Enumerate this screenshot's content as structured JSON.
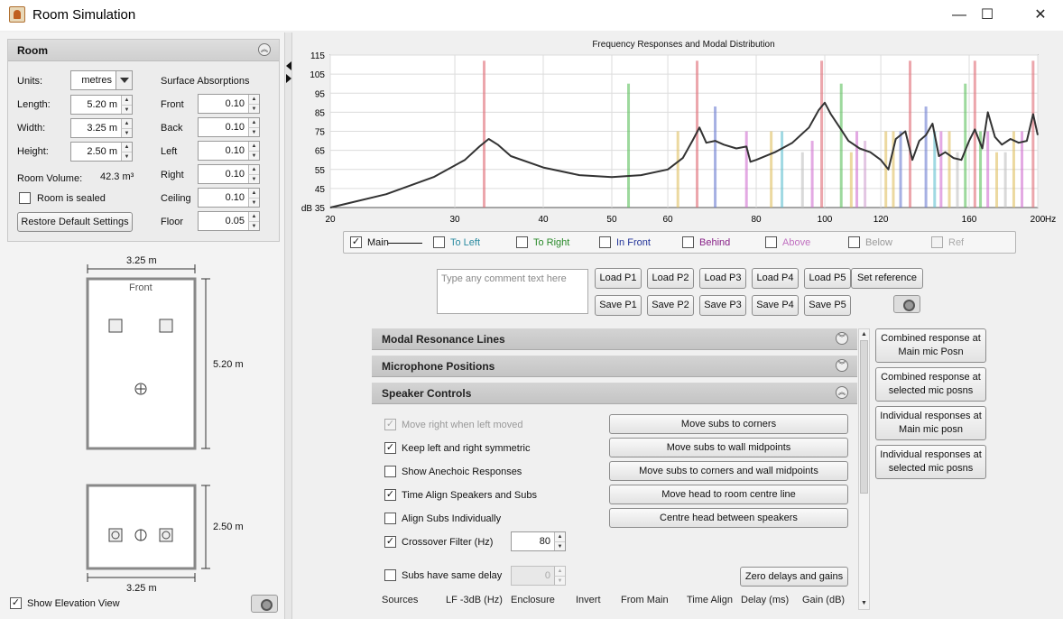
{
  "window": {
    "title": "Room Simulation",
    "minimize": "—",
    "maximize": "☐",
    "close": "✕"
  },
  "room": {
    "header": "Room",
    "units_label": "Units:",
    "units_value": "metres",
    "length_label": "Length:",
    "length_value": "5.20 m",
    "width_label": "Width:",
    "width_value": "3.25 m",
    "height_label": "Height:",
    "height_value": "2.50 m",
    "volume_label": "Room Volume:",
    "volume_value": "42.3 m³",
    "sealed_label": "Room is sealed",
    "restore_label": "Restore Default Settings",
    "absorption_title": "Surface Absorptions",
    "absorptions": [
      {
        "label": "Front",
        "value": "0.10"
      },
      {
        "label": "Back",
        "value": "0.10"
      },
      {
        "label": "Left",
        "value": "0.10"
      },
      {
        "label": "Right",
        "value": "0.10"
      },
      {
        "label": "Ceiling",
        "value": "0.10"
      },
      {
        "label": "Floor",
        "value": "0.05"
      }
    ]
  },
  "plan": {
    "width_label": "3.25 m",
    "length_label": "5.20 m",
    "front_label": "Front",
    "elev_width_label": "3.25 m",
    "elev_height_label": "2.50 m"
  },
  "elevation": {
    "show_label": "Show Elevation View"
  },
  "chart_data": {
    "type": "line",
    "title": "Frequency Responses and Modal Distribution",
    "x_scale": "log",
    "xlim": [
      20,
      200
    ],
    "ylim": [
      35,
      115
    ],
    "x_ticks": [
      20,
      30,
      40,
      50,
      60,
      80,
      100,
      120,
      160,
      200
    ],
    "x_tick_labels": [
      "20",
      "30",
      "40",
      "50",
      "60",
      "80",
      "100",
      "120",
      "160",
      "200"
    ],
    "x_unit": "Hz",
    "y_ticks": [
      115,
      105,
      95,
      85,
      75,
      65,
      55,
      45
    ],
    "y_bottom_label": "dB 35",
    "grid": true,
    "series": [
      {
        "x": [
          20,
          24,
          28,
          31,
          32.5,
          33.5,
          34.5,
          36,
          40,
          45,
          50,
          55,
          60,
          63,
          65,
          66.5,
          68,
          70,
          72,
          75,
          77.5,
          78.5,
          80,
          85,
          90,
          95,
          98,
          100,
          102,
          105,
          108,
          112,
          116,
          120,
          123,
          126,
          130,
          133,
          136,
          139,
          142,
          145,
          148,
          152,
          156,
          160,
          163,
          167,
          170,
          174,
          178,
          183,
          188,
          193,
          197,
          200
        ],
        "y": [
          35,
          42,
          51,
          60,
          67,
          71,
          68,
          62,
          56,
          52,
          51,
          52,
          55,
          61,
          70,
          77,
          69,
          70,
          68,
          66,
          67,
          59,
          60,
          64,
          69,
          77,
          86,
          90,
          84,
          77,
          70,
          66,
          64,
          60,
          55,
          71,
          75,
          60,
          70,
          73,
          79,
          62,
          64,
          61,
          60,
          70,
          76,
          66,
          85,
          72,
          68,
          71,
          69,
          70,
          84,
          73
        ]
      }
    ],
    "modal_lines": [
      {
        "x": 33.0,
        "y": 112,
        "color": "#e06a74"
      },
      {
        "x": 52.8,
        "y": 100,
        "color": "#5bbf5b"
      },
      {
        "x": 62.0,
        "y": 75,
        "color": "#e0c060"
      },
      {
        "x": 66.0,
        "y": 112,
        "color": "#e06a74"
      },
      {
        "x": 70.0,
        "y": 88,
        "color": "#6a7bd0"
      },
      {
        "x": 77.5,
        "y": 75,
        "color": "#d070d0"
      },
      {
        "x": 84.0,
        "y": 75,
        "color": "#e0c060"
      },
      {
        "x": 87.0,
        "y": 75,
        "color": "#60c0d0"
      },
      {
        "x": 93.0,
        "y": 64,
        "color": "#c0c0c0"
      },
      {
        "x": 96.0,
        "y": 70,
        "color": "#d070d0"
      },
      {
        "x": 99.0,
        "y": 112,
        "color": "#e06a74"
      },
      {
        "x": 105.5,
        "y": 100,
        "color": "#5bbf5b"
      },
      {
        "x": 109.0,
        "y": 64,
        "color": "#e0c060"
      },
      {
        "x": 111.0,
        "y": 75,
        "color": "#d070d0"
      },
      {
        "x": 114.0,
        "y": 70,
        "color": "#d0a0d0"
      },
      {
        "x": 122.0,
        "y": 75,
        "color": "#e0c060"
      },
      {
        "x": 125.0,
        "y": 75,
        "color": "#e0c060"
      },
      {
        "x": 128.0,
        "y": 75,
        "color": "#6a7bd0"
      },
      {
        "x": 132.0,
        "y": 112,
        "color": "#e06a74"
      },
      {
        "x": 139.0,
        "y": 88,
        "color": "#6a7bd0"
      },
      {
        "x": 143.0,
        "y": 75,
        "color": "#60c0d0"
      },
      {
        "x": 146.0,
        "y": 75,
        "color": "#d070d0"
      },
      {
        "x": 150.0,
        "y": 75,
        "color": "#e0c060"
      },
      {
        "x": 154.0,
        "y": 64,
        "color": "#c0c0c0"
      },
      {
        "x": 158.0,
        "y": 100,
        "color": "#5bbf5b"
      },
      {
        "x": 163.0,
        "y": 112,
        "color": "#e06a74"
      },
      {
        "x": 166.0,
        "y": 75,
        "color": "#5bbf5b"
      },
      {
        "x": 170.0,
        "y": 75,
        "color": "#d070d0"
      },
      {
        "x": 175.0,
        "y": 64,
        "color": "#e0c060"
      },
      {
        "x": 180.0,
        "y": 64,
        "color": "#c0c0c0"
      },
      {
        "x": 185.0,
        "y": 75,
        "color": "#e0c060"
      },
      {
        "x": 190.0,
        "y": 75,
        "color": "#d070d0"
      },
      {
        "x": 197.0,
        "y": 112,
        "color": "#e06a74"
      }
    ]
  },
  "legend": [
    {
      "label": "Main",
      "checked": true,
      "color": "#111111"
    },
    {
      "label": "To Left",
      "checked": false,
      "color": "#2a8aa0"
    },
    {
      "label": "To Right",
      "checked": false,
      "color": "#2a8a2a"
    },
    {
      "label": "In Front",
      "checked": false,
      "color": "#223399"
    },
    {
      "label": "Behind",
      "checked": false,
      "color": "#882288"
    },
    {
      "label": "Above",
      "checked": false,
      "color": "#c070c0"
    },
    {
      "label": "Below",
      "checked": false,
      "color": "#999999"
    },
    {
      "label": "Ref",
      "checked": false,
      "color": "#aaaaaa"
    }
  ],
  "comment": {
    "placeholder": "Type any comment text here"
  },
  "presets": {
    "load": [
      "Load P1",
      "Load P2",
      "Load P3",
      "Load P4",
      "Load P5"
    ],
    "save": [
      "Save P1",
      "Save P2",
      "Save P3",
      "Save P4",
      "Save P5"
    ],
    "set_reference": "Set reference"
  },
  "sections": {
    "modal": "Modal Resonance Lines",
    "mic": "Microphone Positions",
    "speaker": "Speaker Controls"
  },
  "speaker_controls": {
    "checkboxes": [
      {
        "label": "Move right when left moved",
        "checked": true,
        "disabled": true
      },
      {
        "label": "Keep left and right symmetric",
        "checked": true,
        "disabled": false
      },
      {
        "label": "Show Anechoic Responses",
        "checked": false,
        "disabled": false
      },
      {
        "label": "Time Align Speakers and Subs",
        "checked": true,
        "disabled": false
      },
      {
        "label": "Align Subs Individually",
        "checked": false,
        "disabled": false
      },
      {
        "label": "Crossover Filter (Hz)",
        "checked": true,
        "disabled": false
      }
    ],
    "crossover_value": "80",
    "same_delay_label": "Subs have same delay",
    "same_delay_value": "0",
    "buttons": [
      "Move subs to corners",
      "Move subs to wall midpoints",
      "Move subs to corners and wall midpoints",
      "Move head to room centre line",
      "Centre head between speakers"
    ],
    "zero_delays": "Zero delays and gains",
    "columns": [
      "Sources",
      "LF -3dB (Hz)",
      "Enclosure",
      "Invert",
      "From Main",
      "Time Align",
      "Delay (ms)",
      "Gain (dB)"
    ]
  },
  "response_buttons": [
    "Combined response at Main mic Posn",
    "Combined response at selected mic posns",
    "Individual responses at Main mic posn",
    "Individual responses at selected mic posns"
  ]
}
